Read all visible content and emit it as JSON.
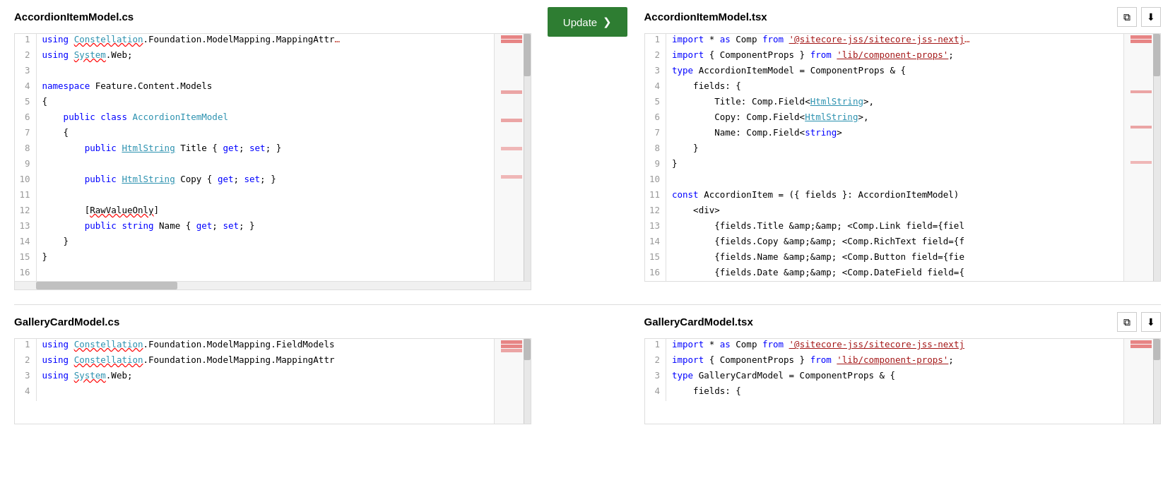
{
  "sections": [
    {
      "id": "accordion",
      "left": {
        "title": "AccordionItemModel.cs",
        "lines": [
          {
            "num": 1,
            "tokens": [
              {
                "t": "kw",
                "v": "using"
              },
              {
                "t": "normal",
                "v": " "
              },
              {
                "t": "teal-underline",
                "v": "Constellation"
              },
              {
                "t": "normal",
                "v": ".Foundation.ModelMapping.MappingAttr"
              }
            ]
          },
          {
            "num": 2,
            "tokens": [
              {
                "t": "kw",
                "v": "using"
              },
              {
                "t": "normal",
                "v": " "
              },
              {
                "t": "teal-underline",
                "v": "System"
              },
              {
                "t": "normal",
                "v": ".Web;"
              }
            ]
          },
          {
            "num": 3,
            "tokens": []
          },
          {
            "num": 4,
            "tokens": [
              {
                "t": "kw",
                "v": "namespace"
              },
              {
                "t": "normal",
                "v": " Feature.Content.Models"
              }
            ]
          },
          {
            "num": 5,
            "tokens": [
              {
                "t": "normal",
                "v": "{"
              }
            ]
          },
          {
            "num": 6,
            "tokens": [
              {
                "t": "normal",
                "v": "    "
              },
              {
                "t": "kw",
                "v": "public"
              },
              {
                "t": "normal",
                "v": " "
              },
              {
                "t": "kw",
                "v": "class"
              },
              {
                "t": "normal",
                "v": " "
              },
              {
                "t": "type",
                "v": "AccordionItemModel"
              }
            ]
          },
          {
            "num": 7,
            "tokens": [
              {
                "t": "normal",
                "v": "    {"
              }
            ]
          },
          {
            "num": 8,
            "tokens": [
              {
                "t": "normal",
                "v": "        "
              },
              {
                "t": "kw",
                "v": "public"
              },
              {
                "t": "normal",
                "v": " "
              },
              {
                "t": "type",
                "v": "HtmlString"
              },
              {
                "t": "normal",
                "v": " Title { "
              },
              {
                "t": "kw",
                "v": "get"
              },
              {
                "t": "normal",
                "v": "; "
              },
              {
                "t": "kw",
                "v": "set"
              },
              {
                "t": "normal",
                "v": "; }"
              }
            ]
          },
          {
            "num": 9,
            "tokens": []
          },
          {
            "num": 10,
            "tokens": [
              {
                "t": "normal",
                "v": "        "
              },
              {
                "t": "kw",
                "v": "public"
              },
              {
                "t": "normal",
                "v": " "
              },
              {
                "t": "type",
                "v": "HtmlString"
              },
              {
                "t": "normal",
                "v": " Copy { "
              },
              {
                "t": "kw",
                "v": "get"
              },
              {
                "t": "normal",
                "v": "; "
              },
              {
                "t": "kw",
                "v": "set"
              },
              {
                "t": "normal",
                "v": "; }"
              }
            ]
          },
          {
            "num": 11,
            "tokens": []
          },
          {
            "num": 12,
            "tokens": [
              {
                "t": "normal",
                "v": "        ["
              },
              {
                "t": "red-underline",
                "v": "RawValueOnly"
              },
              {
                "t": "normal",
                "v": "]"
              }
            ]
          },
          {
            "num": 13,
            "tokens": [
              {
                "t": "normal",
                "v": "        "
              },
              {
                "t": "kw",
                "v": "public"
              },
              {
                "t": "normal",
                "v": " "
              },
              {
                "t": "kw",
                "v": "string"
              },
              {
                "t": "normal",
                "v": " Name { "
              },
              {
                "t": "kw",
                "v": "get"
              },
              {
                "t": "normal",
                "v": "; "
              },
              {
                "t": "kw",
                "v": "set"
              },
              {
                "t": "normal",
                "v": "; }"
              }
            ]
          },
          {
            "num": 14,
            "tokens": [
              {
                "t": "normal",
                "v": "    }"
              }
            ]
          },
          {
            "num": 15,
            "tokens": [
              {
                "t": "normal",
                "v": "}"
              }
            ]
          },
          {
            "num": 16,
            "tokens": []
          }
        ],
        "hasBottomScrollbar": true
      },
      "right": {
        "title": "AccordionItemModel.tsx",
        "lines": [
          {
            "num": 1,
            "tokens": [
              {
                "t": "kw",
                "v": "import"
              },
              {
                "t": "normal",
                "v": " * "
              },
              {
                "t": "kw",
                "v": "as"
              },
              {
                "t": "normal",
                "v": " Comp "
              },
              {
                "t": "kw",
                "v": "from"
              },
              {
                "t": "normal",
                "v": " "
              },
              {
                "t": "str-underline",
                "v": "'@sitecore-jss/sitecore-jss-nextj"
              }
            ]
          },
          {
            "num": 2,
            "tokens": [
              {
                "t": "kw",
                "v": "import"
              },
              {
                "t": "normal",
                "v": " { ComponentProps } "
              },
              {
                "t": "kw",
                "v": "from"
              },
              {
                "t": "normal",
                "v": " "
              },
              {
                "t": "str-underline",
                "v": "'lib/component-props'"
              },
              {
                "t": "normal",
                "v": ";"
              }
            ]
          },
          {
            "num": 3,
            "tokens": [
              {
                "t": "kw",
                "v": "type"
              },
              {
                "t": "normal",
                "v": " AccordionItemModel = ComponentProps & {"
              }
            ]
          },
          {
            "num": 4,
            "tokens": [
              {
                "t": "normal",
                "v": "    fields: {"
              }
            ]
          },
          {
            "num": 5,
            "tokens": [
              {
                "t": "normal",
                "v": "        Title: Comp.Field<"
              },
              {
                "t": "teal-underline",
                "v": "HtmlString"
              },
              {
                "t": "normal",
                "v": ">,"
              }
            ]
          },
          {
            "num": 6,
            "tokens": [
              {
                "t": "normal",
                "v": "        Copy: Comp.Field<"
              },
              {
                "t": "teal-underline",
                "v": "HtmlString"
              },
              {
                "t": "normal",
                "v": ">,"
              }
            ]
          },
          {
            "num": 7,
            "tokens": [
              {
                "t": "normal",
                "v": "        Name: Comp.Field<"
              },
              {
                "t": "kw",
                "v": "string"
              },
              {
                "t": "normal",
                "v": ">"
              }
            ]
          },
          {
            "num": 8,
            "tokens": [
              {
                "t": "normal",
                "v": "    }"
              }
            ]
          },
          {
            "num": 9,
            "tokens": [
              {
                "t": "normal",
                "v": "}"
              }
            ]
          },
          {
            "num": 10,
            "tokens": []
          },
          {
            "num": 11,
            "tokens": [
              {
                "t": "kw",
                "v": "const"
              },
              {
                "t": "normal",
                "v": " AccordionItem = ({ fields }: AccordionItemModel)"
              }
            ]
          },
          {
            "num": 12,
            "tokens": [
              {
                "t": "normal",
                "v": "    <div>"
              }
            ]
          },
          {
            "num": 13,
            "tokens": [
              {
                "t": "normal",
                "v": "        {fields.Title &amp;&amp; <Comp.Link field={fiel"
              }
            ]
          },
          {
            "num": 14,
            "tokens": [
              {
                "t": "normal",
                "v": "        {fields.Copy &amp;&amp; <Comp.RichText field={f"
              }
            ]
          },
          {
            "num": 15,
            "tokens": [
              {
                "t": "normal",
                "v": "        {fields.Name &amp;&amp; <Comp.Button field={fie"
              }
            ]
          },
          {
            "num": 16,
            "tokens": [
              {
                "t": "normal",
                "v": "        {fields.Date &amp;&amp; <Comp.DateField field={"
              }
            ]
          }
        ],
        "hasIcons": true
      },
      "showUpdateBtn": true
    },
    {
      "id": "gallerycard",
      "left": {
        "title": "GalleryCardModel.cs",
        "lines": [
          {
            "num": 1,
            "tokens": [
              {
                "t": "kw",
                "v": "using"
              },
              {
                "t": "normal",
                "v": " "
              },
              {
                "t": "teal-underline",
                "v": "Constellation"
              },
              {
                "t": "normal",
                "v": ".Foundation.ModelMapping.FieldModels"
              }
            ]
          },
          {
            "num": 2,
            "tokens": [
              {
                "t": "kw",
                "v": "using"
              },
              {
                "t": "normal",
                "v": " "
              },
              {
                "t": "teal-underline",
                "v": "Constellation"
              },
              {
                "t": "normal",
                "v": ".Foundation.ModelMapping.MappingAttr"
              }
            ]
          },
          {
            "num": 3,
            "tokens": [
              {
                "t": "kw",
                "v": "using"
              },
              {
                "t": "normal",
                "v": " "
              },
              {
                "t": "teal-underline",
                "v": "System"
              },
              {
                "t": "normal",
                "v": ".Web;"
              }
            ]
          },
          {
            "num": 4,
            "tokens": []
          }
        ],
        "hasBottomScrollbar": false
      },
      "right": {
        "title": "GalleryCardModel.tsx",
        "lines": [
          {
            "num": 1,
            "tokens": [
              {
                "t": "kw",
                "v": "import"
              },
              {
                "t": "normal",
                "v": " * "
              },
              {
                "t": "kw",
                "v": "as"
              },
              {
                "t": "normal",
                "v": " Comp "
              },
              {
                "t": "kw",
                "v": "from"
              },
              {
                "t": "normal",
                "v": " "
              },
              {
                "t": "str-underline",
                "v": "'@sitecore-jss/sitecore-jss-nextj"
              }
            ]
          },
          {
            "num": 2,
            "tokens": [
              {
                "t": "kw",
                "v": "import"
              },
              {
                "t": "normal",
                "v": " { ComponentProps } "
              },
              {
                "t": "kw",
                "v": "from"
              },
              {
                "t": "normal",
                "v": " "
              },
              {
                "t": "str-underline",
                "v": "'lib/component-props'"
              },
              {
                "t": "normal",
                "v": ";"
              }
            ]
          },
          {
            "num": 3,
            "tokens": [
              {
                "t": "kw",
                "v": "type"
              },
              {
                "t": "normal",
                "v": " GalleryCardModel = ComponentProps & {"
              }
            ]
          },
          {
            "num": 4,
            "tokens": [
              {
                "t": "normal",
                "v": "    fields: {"
              }
            ]
          }
        ],
        "hasIcons": true
      },
      "showUpdateBtn": false
    }
  ],
  "updateButton": {
    "label": "Update",
    "arrow": "❯"
  },
  "icons": {
    "copy": "⧉",
    "download": "⬇"
  }
}
